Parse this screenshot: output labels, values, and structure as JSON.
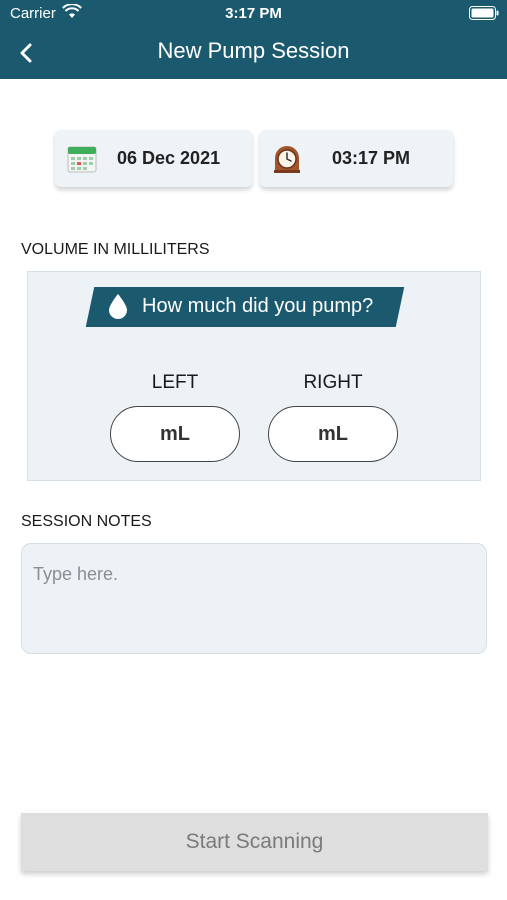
{
  "status_bar": {
    "carrier": "Carrier",
    "time": "3:17 PM"
  },
  "nav": {
    "title": "New Pump Session",
    "back_icon": "chevron-left-icon"
  },
  "date_chip": {
    "icon": "calendar-icon",
    "value": "06 Dec 2021"
  },
  "time_chip": {
    "icon": "clock-icon",
    "value": "03:17 PM"
  },
  "volume": {
    "section_label": "VOLUME IN MILLILITERS",
    "prompt": "How much did you pump?",
    "prompt_icon": "water-drop-icon",
    "left": {
      "label": "LEFT",
      "placeholder": "mL"
    },
    "right": {
      "label": "RIGHT",
      "placeholder": "mL"
    }
  },
  "notes": {
    "section_label": "SESSION NOTES",
    "placeholder": "Type here."
  },
  "start_button": {
    "label": "Start Scanning"
  },
  "colors": {
    "brand": "#1b5a6e",
    "panel": "#ecf2f6",
    "disabled_button": "#dedede"
  }
}
